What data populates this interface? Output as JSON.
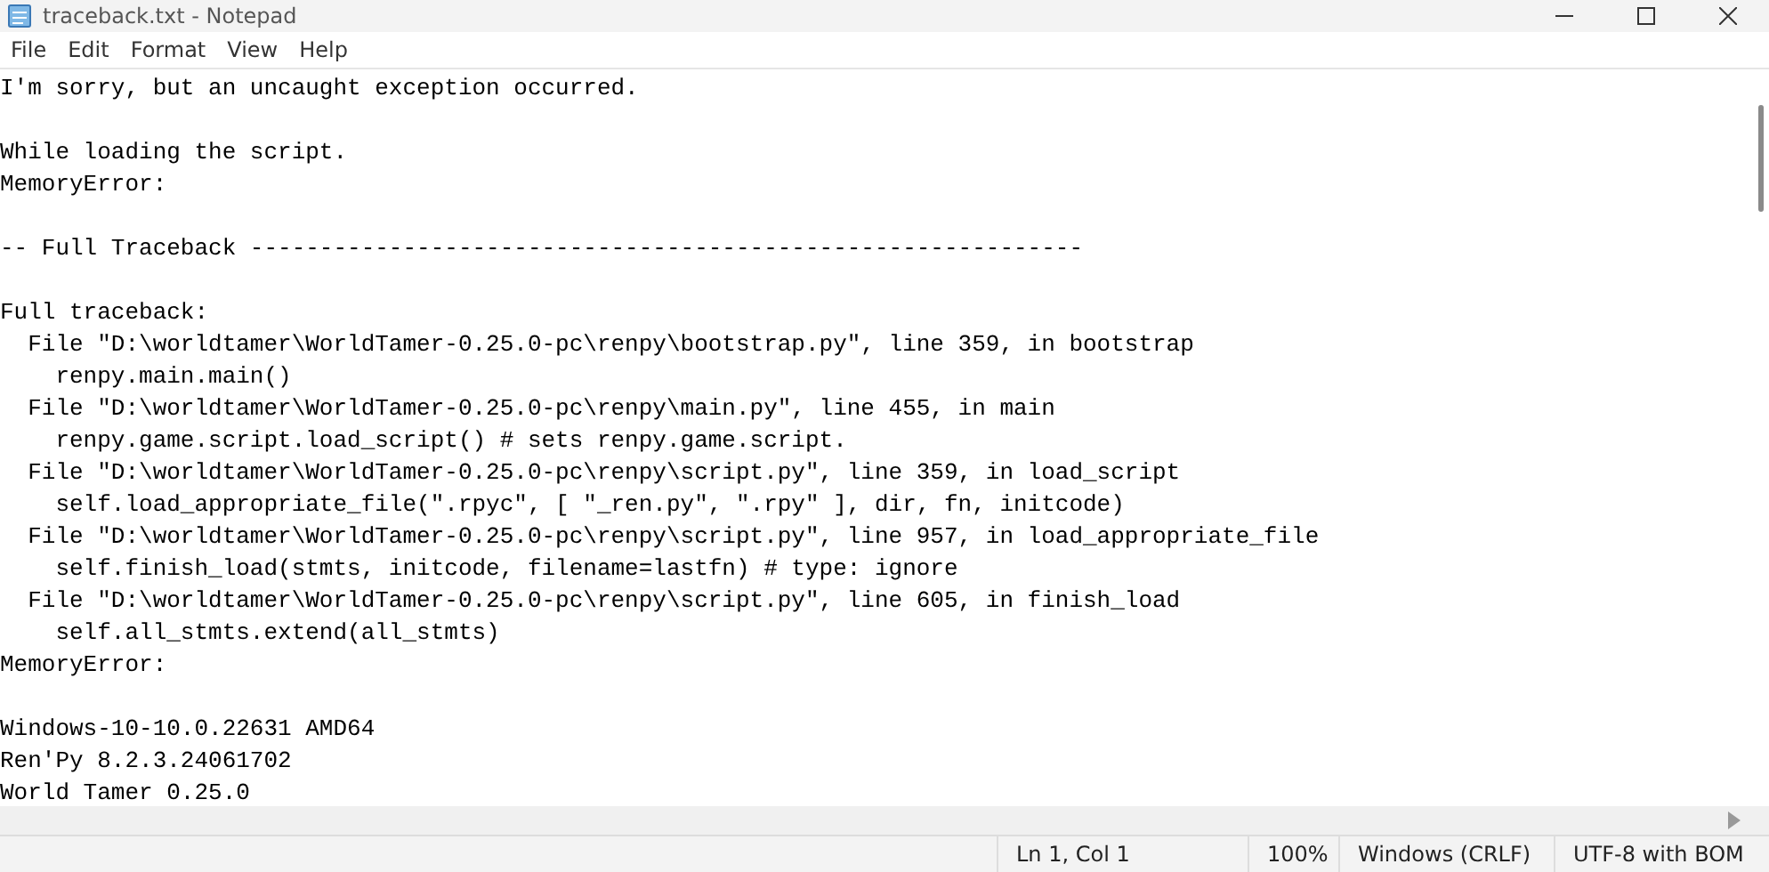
{
  "window": {
    "title": "traceback.txt - Notepad"
  },
  "menu": [
    "File",
    "Edit",
    "Format",
    "View",
    "Help"
  ],
  "document": {
    "blocks": [
      [
        "I'm sorry, but an uncaught exception occurred."
      ],
      [
        "While loading the script.",
        "MemoryError:"
      ],
      [
        "-- Full Traceback ------------------------------------------------------------"
      ],
      [
        "Full traceback:",
        "  File \"D:\\worldtamer\\WorldTamer-0.25.0-pc\\renpy\\bootstrap.py\", line 359, in bootstrap",
        "    renpy.main.main()",
        "  File \"D:\\worldtamer\\WorldTamer-0.25.0-pc\\renpy\\main.py\", line 455, in main",
        "    renpy.game.script.load_script() # sets renpy.game.script.",
        "  File \"D:\\worldtamer\\WorldTamer-0.25.0-pc\\renpy\\script.py\", line 359, in load_script",
        "    self.load_appropriate_file(\".rpyc\", [ \"_ren.py\", \".rpy\" ], dir, fn, initcode)",
        "  File \"D:\\worldtamer\\WorldTamer-0.25.0-pc\\renpy\\script.py\", line 957, in load_appropriate_file",
        "    self.finish_load(stmts, initcode, filename=lastfn) # type: ignore",
        "  File \"D:\\worldtamer\\WorldTamer-0.25.0-pc\\renpy\\script.py\", line 605, in finish_load",
        "    self.all_stmts.extend(all_stmts)",
        "MemoryError:"
      ],
      [
        "Windows-10-10.0.22631 AMD64",
        "Ren'Py 8.2.3.24061702",
        "World Tamer 0.25.0"
      ]
    ]
  },
  "status_bar": [
    "Ln 1, Col 1",
    "100%",
    "Windows (CRLF)",
    "UTF-8 with BOM"
  ]
}
